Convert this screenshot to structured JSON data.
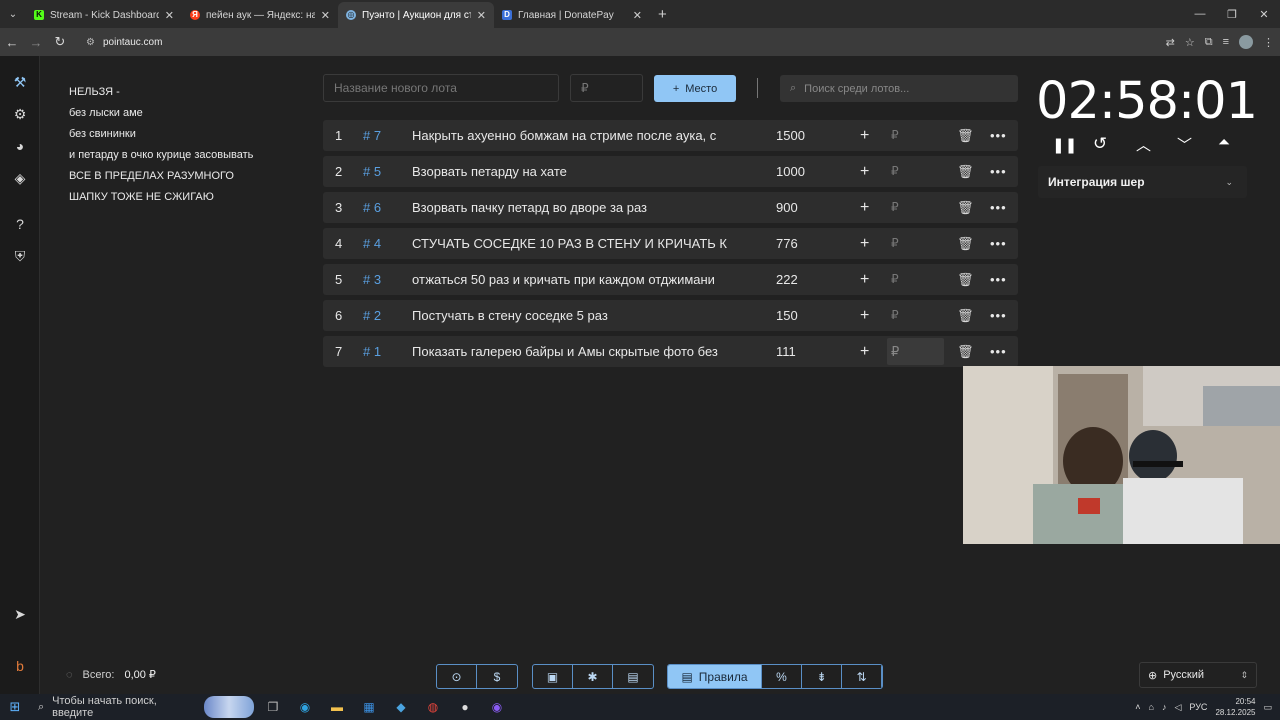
{
  "browser": {
    "tabs": [
      {
        "title": "Stream - Kick Dashboard",
        "active": false,
        "favicon_color": "#53fc18",
        "favicon_char": "K"
      },
      {
        "title": "пейен аук — Яндекс: нашлось",
        "active": false,
        "favicon_color": "#fc3f1d",
        "favicon_char": "Я"
      },
      {
        "title": "Пуэнто | Аукцион для стримеров",
        "active": true,
        "favicon_color": "#7fb3e0",
        "favicon_char": "◎"
      },
      {
        "title": "Главная | DonatePay",
        "active": false,
        "favicon_color": "#3a6fd8",
        "favicon_char": "D"
      }
    ],
    "url": "pointauc.com"
  },
  "rules": {
    "lines": [
      "НЕЛЬЗЯ -",
      "без лыски аме",
      "без свининки",
      "и петарду в очко курице засовывать",
      "ВСЕ В ПРЕДЕЛАХ РАЗУМНОГО",
      "ШАПКУ ТОЖЕ НЕ СЖИГАЮ"
    ]
  },
  "toolbar": {
    "lot_name_placeholder": "Название нового лота",
    "amount_placeholder": "₽",
    "place_button": "Место",
    "search_placeholder": "Поиск среди лотов..."
  },
  "lots": [
    {
      "num": "1",
      "id": "# 7",
      "name": "Накрыть ахуенно бомжам на стриме после аука, с",
      "amount": "1500",
      "currency": "₽"
    },
    {
      "num": "2",
      "id": "# 5",
      "name": "Взорвать петарду на хате",
      "amount": "1000",
      "currency": "₽"
    },
    {
      "num": "3",
      "id": "# 6",
      "name": "Взорвать пачку петард во дворе за раз",
      "amount": "900",
      "currency": "₽"
    },
    {
      "num": "4",
      "id": "# 4",
      "name": "СТУЧАТЬ СОСЕДКЕ 10 РАЗ В СТЕНУ И КРИЧАТЬ К",
      "amount": "776",
      "currency": "₽"
    },
    {
      "num": "5",
      "id": "# 3",
      "name": "отжаться 50 раз и кричать при каждом отджимани",
      "amount": "222",
      "currency": "₽"
    },
    {
      "num": "6",
      "id": "# 2",
      "name": "Постучать в стену соседке 5 раз",
      "amount": "150",
      "currency": "₽"
    },
    {
      "num": "7",
      "id": "# 1",
      "name": "Показать галерею байры и Амы скрытые фото без",
      "amount": "111",
      "currency": "₽"
    }
  ],
  "timer": {
    "display": "02:58:01"
  },
  "integration": {
    "label": "Интеграция шер"
  },
  "footer": {
    "total_label": "Всего:",
    "total_value": "0,00 ₽",
    "rules_button": "Правила",
    "language": "Русский"
  },
  "taskbar": {
    "search_placeholder": "Чтобы начать поиск, введите",
    "lang": "РУС",
    "time": "20:54",
    "date": "28.12.2025"
  },
  "colors": {
    "accent": "#90c6f5",
    "lot_id": "#5a9fe0",
    "row_bg": "#2d2d2d"
  }
}
